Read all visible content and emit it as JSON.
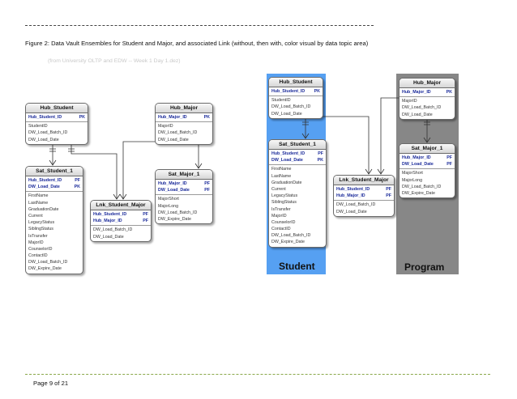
{
  "caption": "Figure 2:  Data Vault Ensembles for Student and Major, and associated Link (without, then with, color visual by data topic area)",
  "source": "(from University OLTP and EDW -- Week 1 Day 1.dez)",
  "footer": "Page 9 of 21",
  "colors": {
    "student_area": "#56a0f2",
    "program_area": "#878787",
    "key_text": "#1a2a9a"
  },
  "entities": {
    "hub_student": {
      "title": "Hub_Student",
      "keys": [
        {
          "name": "Hub_Student_ID",
          "tag": "PK"
        }
      ],
      "attrs": [
        "StudentID",
        "DW_Load_Batch_ID",
        "DW_Load_Date"
      ]
    },
    "hub_major": {
      "title": "Hub_Major",
      "keys": [
        {
          "name": "Hub_Major_ID",
          "tag": "PK"
        }
      ],
      "attrs": [
        "MajorID",
        "DW_Load_Batch_ID",
        "DW_Load_Date"
      ]
    },
    "sat_student_1": {
      "title": "Sat_Student_1",
      "keys": [
        {
          "name": "Hub_Student_ID",
          "tag": "PF"
        },
        {
          "name": "DW_Load_Date",
          "tag": "PK"
        }
      ],
      "attrs": [
        "FirstName",
        "LastName",
        "GraduationDate",
        "Current",
        "LegacyStatus",
        "SiblingStatus",
        "IsTransfer",
        "MajorID",
        "CounselorID",
        "ContactID",
        "DW_Load_Batch_ID",
        "DW_Expire_Date"
      ]
    },
    "sat_major_1": {
      "title": "Sat_Major_1",
      "keys": [
        {
          "name": "Hub_Major_ID",
          "tag": "PF"
        },
        {
          "name": "DW_Load_Date",
          "tag": "PF"
        }
      ],
      "attrs": [
        "MajorShort",
        "MajorLong",
        "DW_Load_Batch_ID",
        "DW_Expire_Date"
      ]
    },
    "lnk_student_major": {
      "title": "Lnk_Student_Major",
      "keys": [
        {
          "name": "Hub_Student_ID",
          "tag": "PF"
        },
        {
          "name": "Hub_Major_ID",
          "tag": "PF"
        }
      ],
      "attrs": [
        "DW_Load_Batch_ID",
        "DW_Load_Date"
      ]
    }
  },
  "areas": {
    "student": "Student",
    "program": "Program"
  }
}
